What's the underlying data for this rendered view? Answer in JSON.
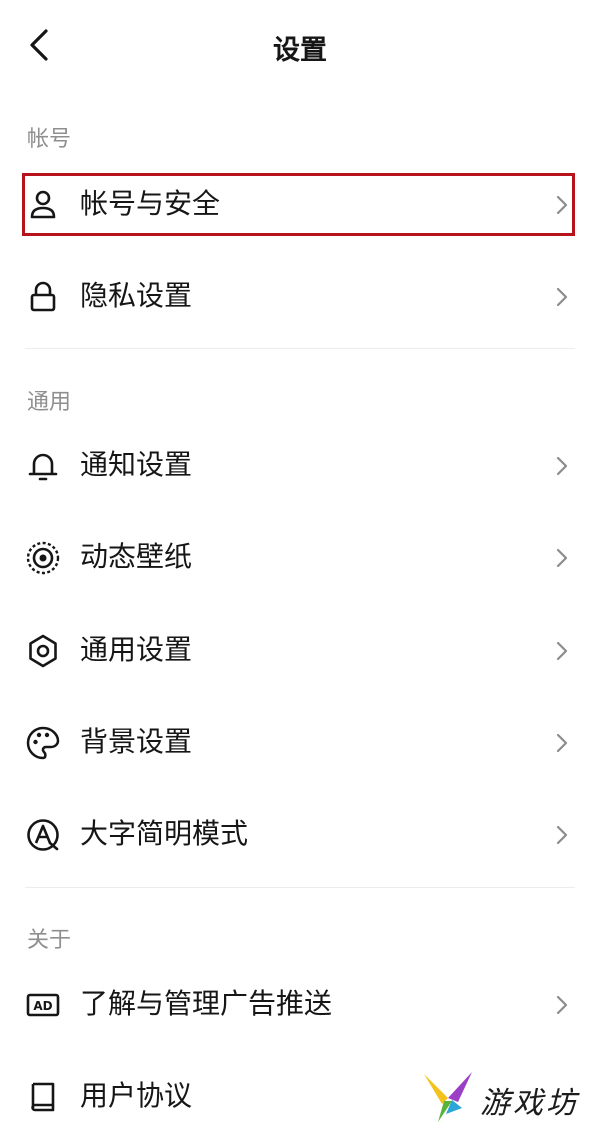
{
  "header": {
    "title": "设置"
  },
  "sections": [
    {
      "label": "帐号"
    },
    {
      "label": "通用"
    },
    {
      "label": "关于"
    }
  ],
  "items": [
    {
      "label": "帐号与安全",
      "icon": "user-icon"
    },
    {
      "label": "隐私设置",
      "icon": "lock-icon"
    },
    {
      "label": "通知设置",
      "icon": "bell-icon"
    },
    {
      "label": "动态壁纸",
      "icon": "wallpaper-icon"
    },
    {
      "label": "通用设置",
      "icon": "gear-icon"
    },
    {
      "label": "背景设置",
      "icon": "palette-icon"
    },
    {
      "label": "大字简明模式",
      "icon": "large-text-icon"
    },
    {
      "label": "了解与管理广告推送",
      "icon": "ad-icon"
    },
    {
      "label": "用户协议",
      "icon": "book-icon"
    }
  ],
  "highlight_color": "#b8121a",
  "watermark": {
    "text": "游戏坊"
  }
}
